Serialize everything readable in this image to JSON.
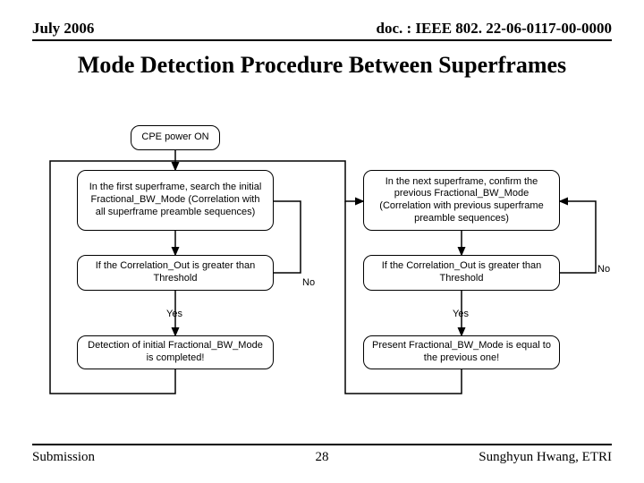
{
  "header": {
    "date": "July 2006",
    "doc": "doc. : IEEE 802. 22-06-0117-00-0000"
  },
  "title": "Mode Detection Procedure Between Superframes",
  "footer": {
    "left": "Submission",
    "page": "28",
    "right": "Sunghyun Hwang, ETRI"
  },
  "flow": {
    "start": "CPE power ON",
    "left": {
      "step1": "In the first superframe, search the initial Fractional_BW_Mode (Correlation with all superframe preamble sequences)",
      "step2": "If the Correlation_Out is greater than Threshold",
      "step3": "Detection of initial Fractional_BW_Mode is completed!"
    },
    "right": {
      "step1": "In the next superframe, confirm the previous Fractional_BW_Mode (Correlation with previous superframe preamble sequences)",
      "step2": "If the Correlation_Out is greater than Threshold",
      "step3": "Present Fractional_BW_Mode is equal to the previous one!"
    },
    "labels": {
      "yes": "Yes",
      "no": "No"
    }
  }
}
